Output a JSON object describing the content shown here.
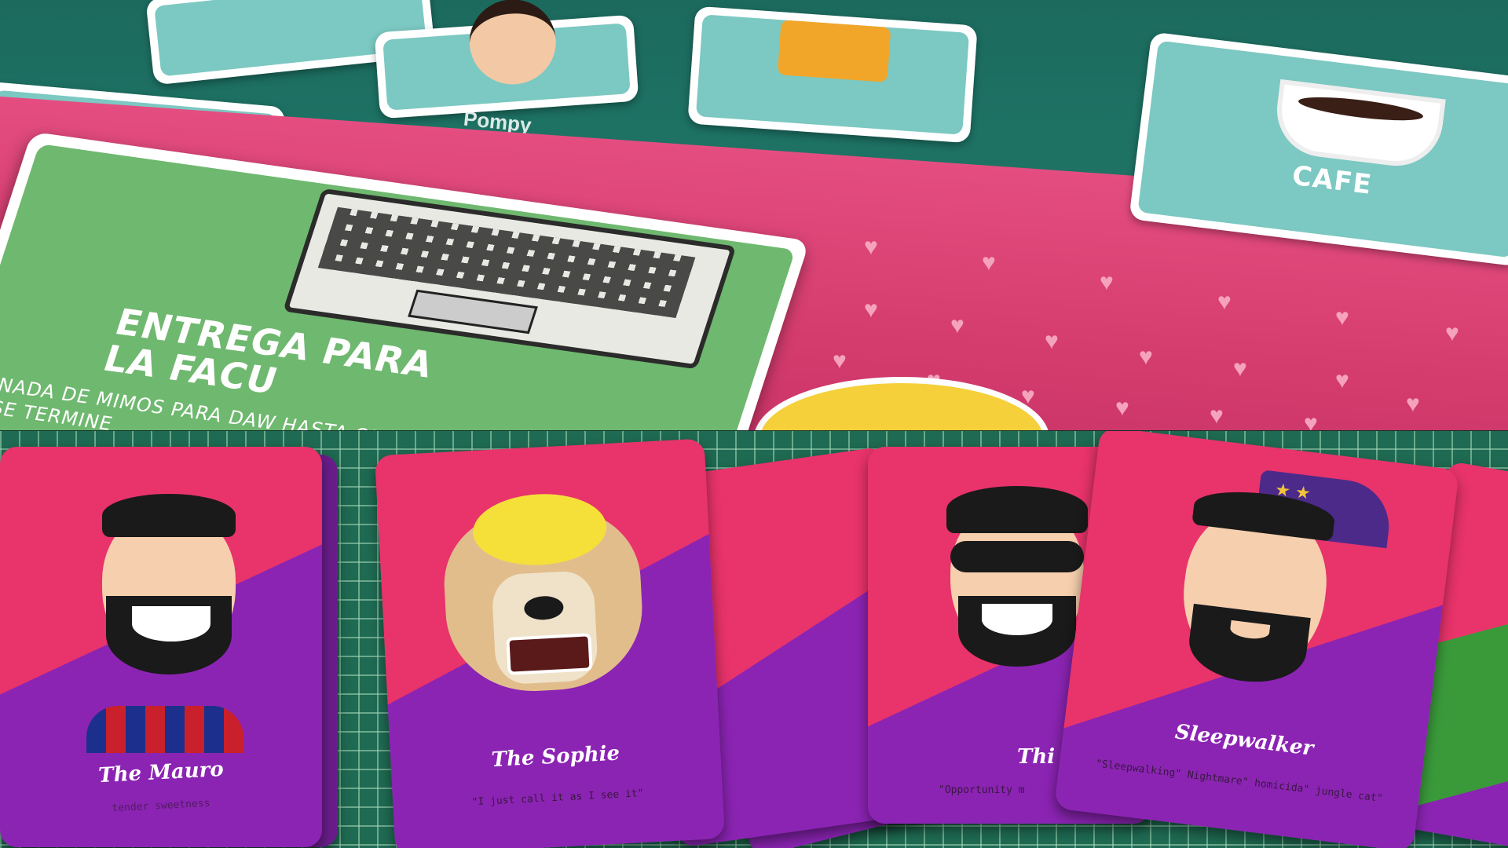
{
  "top_scene": {
    "laptop_card": {
      "title": "ENTREGA PARA LA FACU",
      "subtitle": "NADA DE MIMOS PARA DAW HASTA QUE NO SE TERMINE"
    },
    "coffee_card": {
      "title": "CAFE"
    }
  },
  "bottom_scene": {
    "cards": [
      {
        "name": "The Mauro",
        "quote": "tender sweetness"
      },
      {
        "name": "The Sophie",
        "quote": "\"I just call it as I see it\""
      },
      {
        "name": "Thi",
        "quote": "\"Opportunity m"
      },
      {
        "name": "Sleepwalker",
        "quote": "\"Sleepwalking\" Nightmare\" homicida\" jungle cat\""
      }
    ]
  },
  "colors": {
    "pink": "#e0437a",
    "purple": "#7a1fa8",
    "teal": "#1d7264",
    "mint": "#7cc8c2"
  }
}
